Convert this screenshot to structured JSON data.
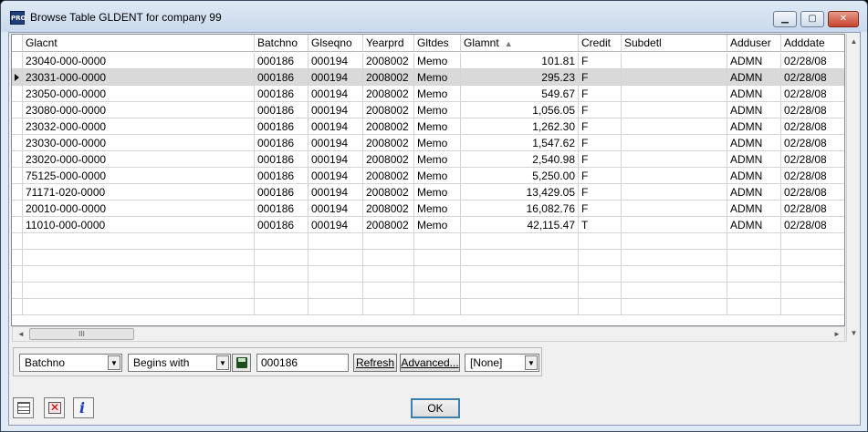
{
  "window": {
    "title": "Browse Table GLDENT for company 99",
    "app_badge": "PRO"
  },
  "grid": {
    "columns": [
      {
        "key": "glacnt",
        "label": "Glacnt",
        "width": 254,
        "align": "left"
      },
      {
        "key": "batchno",
        "label": "Batchno",
        "width": 59,
        "align": "left"
      },
      {
        "key": "glseqno",
        "label": "Glseqno",
        "width": 60,
        "align": "left"
      },
      {
        "key": "yearprd",
        "label": "Yearprd",
        "width": 56,
        "align": "left"
      },
      {
        "key": "gltdes",
        "label": "Gltdes",
        "width": 51,
        "align": "left"
      },
      {
        "key": "glamnt",
        "label": "Glamnt",
        "width": 129,
        "align": "right",
        "sorted": true
      },
      {
        "key": "credit",
        "label": "Credit",
        "width": 47,
        "align": "left"
      },
      {
        "key": "subdetl",
        "label": "Subdetl",
        "width": 116,
        "align": "left"
      },
      {
        "key": "adduser",
        "label": "Adduser",
        "width": 59,
        "align": "left"
      },
      {
        "key": "adddate",
        "label": "Adddate",
        "width": 71,
        "align": "left"
      }
    ],
    "sort_indicator": "▲",
    "selected_row": 1,
    "rows": [
      {
        "glacnt": "23040-000-0000",
        "batchno": "000186",
        "glseqno": "000194",
        "yearprd": "2008002",
        "gltdes": "Memo",
        "glamnt": "101.81",
        "credit": "F",
        "subdetl": "",
        "adduser": "ADMN",
        "adddate": "02/28/08"
      },
      {
        "glacnt": "23031-000-0000",
        "batchno": "000186",
        "glseqno": "000194",
        "yearprd": "2008002",
        "gltdes": "Memo",
        "glamnt": "295.23",
        "credit": "F",
        "subdetl": "",
        "adduser": "ADMN",
        "adddate": "02/28/08"
      },
      {
        "glacnt": "23050-000-0000",
        "batchno": "000186",
        "glseqno": "000194",
        "yearprd": "2008002",
        "gltdes": "Memo",
        "glamnt": "549.67",
        "credit": "F",
        "subdetl": "",
        "adduser": "ADMN",
        "adddate": "02/28/08"
      },
      {
        "glacnt": "23080-000-0000",
        "batchno": "000186",
        "glseqno": "000194",
        "yearprd": "2008002",
        "gltdes": "Memo",
        "glamnt": "1,056.05",
        "credit": "F",
        "subdetl": "",
        "adduser": "ADMN",
        "adddate": "02/28/08"
      },
      {
        "glacnt": "23032-000-0000",
        "batchno": "000186",
        "glseqno": "000194",
        "yearprd": "2008002",
        "gltdes": "Memo",
        "glamnt": "1,262.30",
        "credit": "F",
        "subdetl": "",
        "adduser": "ADMN",
        "adddate": "02/28/08"
      },
      {
        "glacnt": "23030-000-0000",
        "batchno": "000186",
        "glseqno": "000194",
        "yearprd": "2008002",
        "gltdes": "Memo",
        "glamnt": "1,547.62",
        "credit": "F",
        "subdetl": "",
        "adduser": "ADMN",
        "adddate": "02/28/08"
      },
      {
        "glacnt": "23020-000-0000",
        "batchno": "000186",
        "glseqno": "000194",
        "yearprd": "2008002",
        "gltdes": "Memo",
        "glamnt": "2,540.98",
        "credit": "F",
        "subdetl": "",
        "adduser": "ADMN",
        "adddate": "02/28/08"
      },
      {
        "glacnt": "75125-000-0000",
        "batchno": "000186",
        "glseqno": "000194",
        "yearprd": "2008002",
        "gltdes": "Memo",
        "glamnt": "5,250.00",
        "credit": "F",
        "subdetl": "",
        "adduser": "ADMN",
        "adddate": "02/28/08"
      },
      {
        "glacnt": "71171-020-0000",
        "batchno": "000186",
        "glseqno": "000194",
        "yearprd": "2008002",
        "gltdes": "Memo",
        "glamnt": "13,429.05",
        "credit": "F",
        "subdetl": "",
        "adduser": "ADMN",
        "adddate": "02/28/08"
      },
      {
        "glacnt": "20010-000-0000",
        "batchno": "000186",
        "glseqno": "000194",
        "yearprd": "2008002",
        "gltdes": "Memo",
        "glamnt": "16,082.76",
        "credit": "F",
        "subdetl": "",
        "adduser": "ADMN",
        "adddate": "02/28/08"
      },
      {
        "glacnt": "11010-000-0000",
        "batchno": "000186",
        "glseqno": "000194",
        "yearprd": "2008002",
        "gltdes": "Memo",
        "glamnt": "42,115.47",
        "credit": "T",
        "subdetl": "",
        "adduser": "ADMN",
        "adddate": "02/28/08"
      }
    ],
    "empty_row_count": 5
  },
  "scrollbar": {
    "left_arrow": "◄",
    "right_arrow": "►",
    "up_arrow": "▲",
    "down_arrow": "▼",
    "thumb_grip": "III"
  },
  "filter": {
    "field_value": "Batchno",
    "operator_value": "Begins with",
    "search_value": "000186",
    "refresh_label": "Refresh",
    "advanced_label": "Advanced...",
    "preset_value": "[None]",
    "drop_arrow": "▼"
  },
  "footer": {
    "ok_label": "OK",
    "info_glyph": "i"
  },
  "colors": {
    "selected_row": "#d9d9d9",
    "ok_border": "#3c7fb1",
    "title_bg": "#dfe9f5"
  }
}
